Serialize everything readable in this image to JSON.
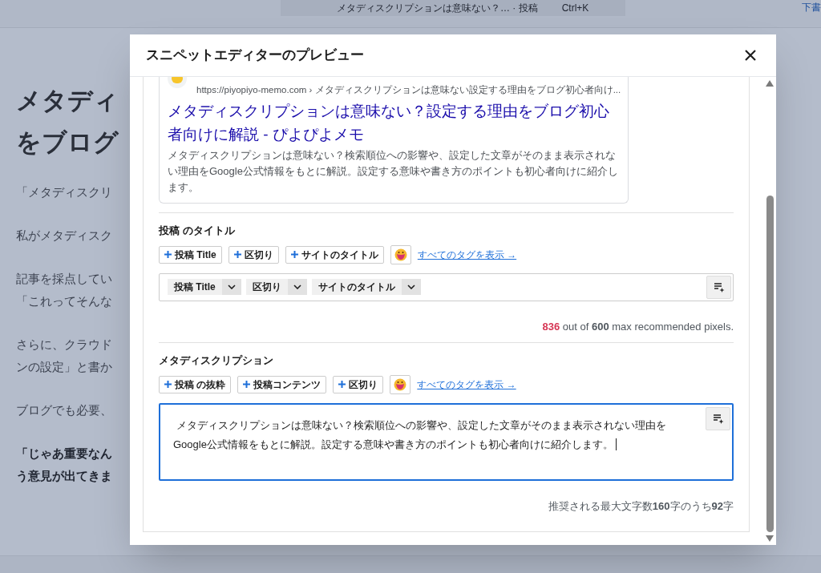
{
  "background": {
    "search_text": "メタディスクリプションは意味ない？…  · 投稿",
    "shortcut": "Ctrl+K",
    "top_right": "下書",
    "heading": [
      "メタディ",
      "をブログ"
    ],
    "paragraphs": [
      {
        "lines": [
          "「メタディスクリ"
        ],
        "bold": false
      },
      {
        "lines": [
          "私がメタディスク"
        ],
        "bold": false
      },
      {
        "lines": [
          "記事を採点してい",
          "「これってそんな"
        ],
        "bold": false
      },
      {
        "lines": [
          "さらに、クラウド",
          "ンの設定」と書か"
        ],
        "bold": false
      },
      {
        "lines": [
          "ブログでも必要、"
        ],
        "bold": false
      },
      {
        "lines": [
          "「じゃあ重要なん",
          "う意見が出てきま"
        ],
        "bold": true
      }
    ]
  },
  "dialog": {
    "title": "スニペットエディターのプレビュー",
    "preview": {
      "url": "https://piyopiyo-memo.com › メタディスクリプションは意味ない設定する理由をブログ初心者向け...",
      "title": "メタディスクリプションは意味ない？設定する理由をブログ初心者向けに解説 - ぴよぴよメモ",
      "description": "メタディスクリプションは意味ない？検索順位への影響や、設定した文章がそのまま表示されない理由をGoogle公式情報をもとに解説。設定する意味や書き方のポイントも初心者向けに紹介します。"
    },
    "sections": [
      {
        "kind": "tags",
        "label": "投稿 のタイトル",
        "tag_buttons": [
          "投稿 Title",
          "区切り",
          "サイトのタイトル"
        ],
        "all_tags_link": "すべてのタグを表示 →",
        "chips": [
          "投稿 Title",
          "区切り",
          "サイトのタイトル"
        ],
        "counter": "**836** out of **600** max recommended pixels.",
        "over_limit": true
      },
      {
        "kind": "text",
        "label": "メタディスクリプション",
        "tag_buttons": [
          "投稿 の抜粋",
          "投稿コンテンツ",
          "区切り"
        ],
        "all_tags_link": "すべてのタグを表示 →",
        "value": " メタディスクリプションは意味ない？検索順位への影響や、設定した文章がそのまま表示されない理由をGoogle公式情報をもとに解説。設定する意味や書き方のポイントも初心者向けに紹介します。",
        "focused": true,
        "counter": "推奨される最大文字数**160**字のうち**92**字"
      }
    ]
  }
}
